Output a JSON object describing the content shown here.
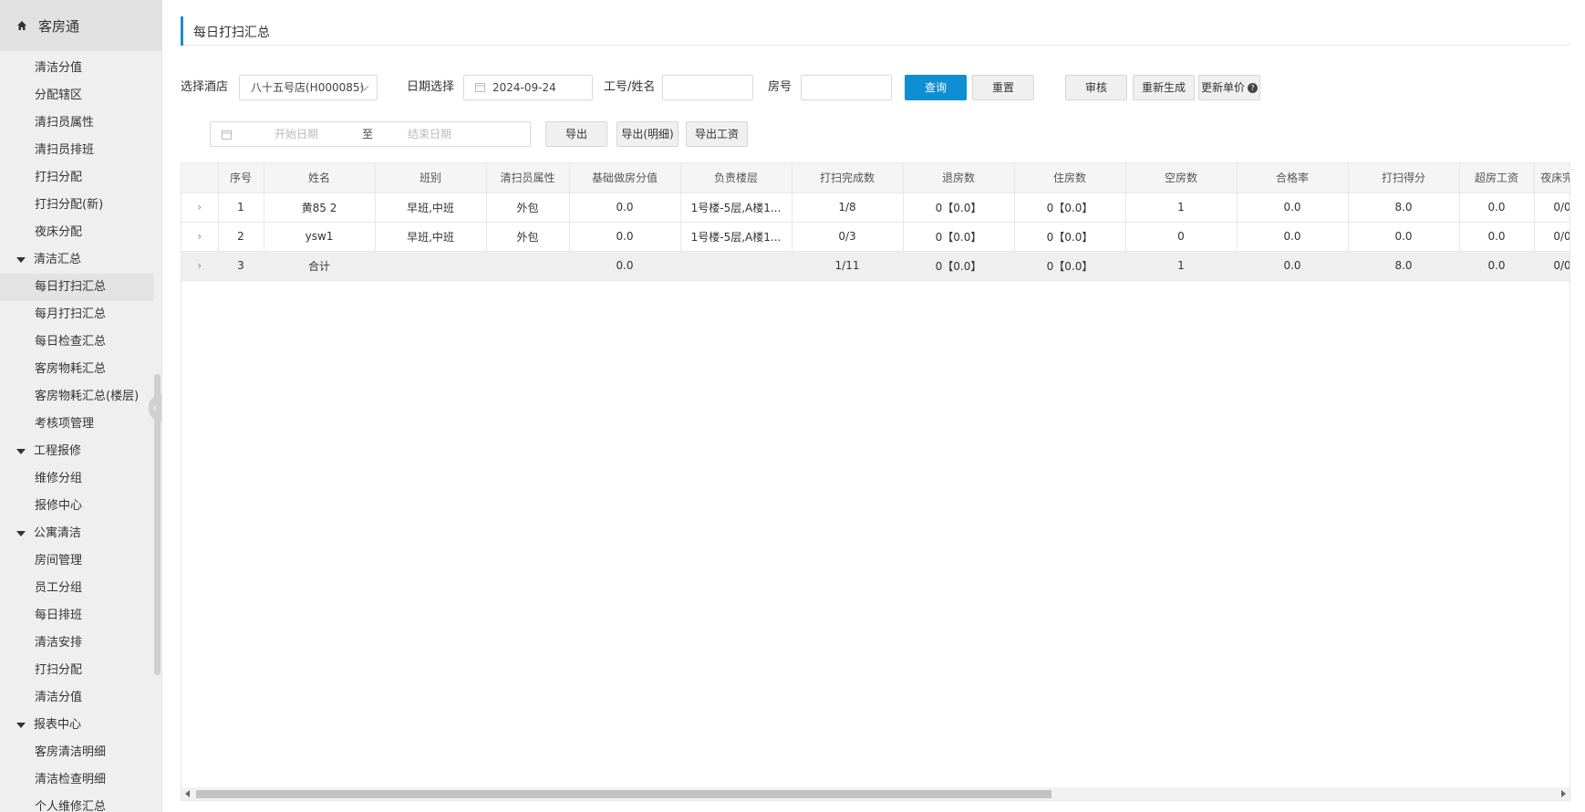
{
  "app": {
    "title": "客房通"
  },
  "sidebar": {
    "items": [
      {
        "type": "item",
        "label": "清洁分值"
      },
      {
        "type": "item",
        "label": "分配辖区"
      },
      {
        "type": "item",
        "label": "清扫员属性"
      },
      {
        "type": "item",
        "label": "清扫员排班"
      },
      {
        "type": "item",
        "label": "打扫分配"
      },
      {
        "type": "item",
        "label": "打扫分配(新)"
      },
      {
        "type": "item",
        "label": "夜床分配"
      },
      {
        "type": "group",
        "label": "清洁汇总"
      },
      {
        "type": "item",
        "label": "每日打扫汇总",
        "active": true
      },
      {
        "type": "item",
        "label": "每月打扫汇总"
      },
      {
        "type": "item",
        "label": "每日检查汇总"
      },
      {
        "type": "item",
        "label": "客房物耗汇总"
      },
      {
        "type": "item",
        "label": "客房物耗汇总(楼层)"
      },
      {
        "type": "item",
        "label": "考核项管理"
      },
      {
        "type": "group",
        "label": "工程报修"
      },
      {
        "type": "item",
        "label": "维修分组"
      },
      {
        "type": "item",
        "label": "报修中心"
      },
      {
        "type": "group",
        "label": "公寓清洁"
      },
      {
        "type": "item",
        "label": "房间管理"
      },
      {
        "type": "item",
        "label": "员工分组"
      },
      {
        "type": "item",
        "label": "每日排班"
      },
      {
        "type": "item",
        "label": "清洁安排"
      },
      {
        "type": "item",
        "label": "打扫分配"
      },
      {
        "type": "item",
        "label": "清洁分值"
      },
      {
        "type": "group",
        "label": "报表中心"
      },
      {
        "type": "item",
        "label": "客房清洁明细"
      },
      {
        "type": "item",
        "label": "清洁检查明细"
      },
      {
        "type": "item",
        "label": "个人维修汇总"
      }
    ]
  },
  "page": {
    "title": "每日打扫汇总"
  },
  "filters": {
    "hotel_label": "选择酒店",
    "hotel_value": "八十五号店(H000085)",
    "date_label": "日期选择",
    "date_value": "2024-09-24",
    "employee_label": "工号/姓名",
    "employee_value": "",
    "room_label": "房号",
    "room_value": "",
    "start_placeholder": "开始日期",
    "range_sep": "至",
    "end_placeholder": "结束日期"
  },
  "buttons": {
    "query": "查询",
    "reset": "重置",
    "audit": "审核",
    "regenerate": "重新生成",
    "update_price": "更新单价",
    "export": "导出",
    "export_detail": "导出(明细)",
    "export_wage": "导出工资"
  },
  "table": {
    "headers": [
      "",
      "序号",
      "姓名",
      "班别",
      "清扫员属性",
      "基础做房分值",
      "负责楼层",
      "打扫完成数",
      "退房数",
      "住房数",
      "空房数",
      "合格率",
      "打扫得分",
      "超房工资",
      "夜床完..."
    ],
    "rows": [
      [
        "›",
        "1",
        "黄85 2",
        "早班,中班",
        "外包",
        "0.0",
        "1号楼-5层,A楼1...",
        "1/8",
        "0【0.0】",
        "0【0.0】",
        "1",
        "0.0",
        "8.0",
        "0.0",
        "0/0"
      ],
      [
        "›",
        "2",
        "ysw1",
        "早班,中班",
        "外包",
        "0.0",
        "1号楼-5层,A楼1...",
        "0/3",
        "0【0.0】",
        "0【0.0】",
        "0",
        "0.0",
        "0.0",
        "0.0",
        "0/0"
      ]
    ],
    "total_row": [
      "›",
      "3",
      "合计",
      "",
      "",
      "0.0",
      "",
      "1/11",
      "0【0.0】",
      "0【0.0】",
      "1",
      "0.0",
      "8.0",
      "0.0",
      "0/0"
    ]
  }
}
